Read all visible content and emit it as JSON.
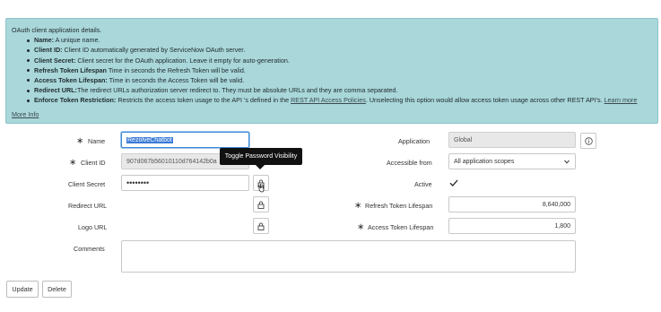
{
  "info": {
    "heading": "OAuth client application details.",
    "items": [
      {
        "term": "Name:",
        "desc": " A unique name."
      },
      {
        "term": "Client ID:",
        "desc": " Client ID automatically generated by ServiceNow OAuth server."
      },
      {
        "term": "Client Secret:",
        "desc": " Client secret for the OAuth application. Leave it empty for auto-generation."
      },
      {
        "term": "Refresh Token Lifespan",
        "desc": " Time in seconds the Refresh Token will be valid."
      },
      {
        "term": "Access Token Lifespan:",
        "desc": " Time in seconds the Access Token will be valid."
      },
      {
        "term": "Redirect URL:",
        "desc": "The redirect URLs authorization server redirect to. They must be absolute URLs and they are comma separated."
      }
    ],
    "enforce": {
      "term": "Enforce Token Restriction:",
      "desc_before": " Restricts the access token usage to the API 's defined in the ",
      "link1": "REST API Access Policies",
      "desc_after": ". Unselecting this option would allow access token usage across other REST API's. ",
      "link2": "Learn more"
    },
    "more_info": "More Info"
  },
  "form": {
    "name_label": "Name",
    "name_value": "RezolveChatbot",
    "client_id_label": "Client ID",
    "client_id_value": "907d067b56010110d764142b0a",
    "client_secret_label": "Client Secret",
    "client_secret_value": "••••••••",
    "redirect_url_label": "Redirect URL",
    "logo_url_label": "Logo URL",
    "comments_label": "Comments",
    "application_label": "Application",
    "application_value": "Global",
    "accessible_from_label": "Accessible from",
    "accessible_from_value": "All application scopes",
    "active_label": "Active",
    "active_checked": true,
    "refresh_label": "Refresh Token Lifespan",
    "refresh_value": "8,640,000",
    "access_label": "Access Token Lifespan",
    "access_value": "1,800",
    "required_marker": "∗"
  },
  "tooltip": "Toggle Password Visibility",
  "buttons": {
    "update": "Update",
    "delete": "Delete"
  },
  "icons": {
    "lock": "lock-icon",
    "info": "info-icon",
    "check": "check-icon",
    "caret": "chevron-down-icon"
  }
}
